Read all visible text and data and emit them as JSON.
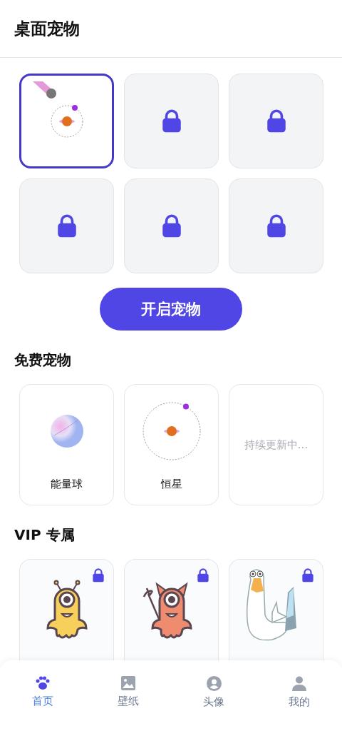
{
  "header": {
    "title": "桌面宠物"
  },
  "slots": [
    {
      "kind": "star",
      "selected": true
    },
    {
      "kind": "locked",
      "selected": false
    },
    {
      "kind": "locked",
      "selected": false
    },
    {
      "kind": "locked",
      "selected": false
    },
    {
      "kind": "locked",
      "selected": false
    },
    {
      "kind": "locked",
      "selected": false
    }
  ],
  "start_button": "开启宠物",
  "free_section": {
    "title": "免费宠物",
    "items": [
      {
        "kind": "orb",
        "label": "能量球"
      },
      {
        "kind": "star",
        "label": "恒星"
      },
      {
        "kind": "placeholder",
        "label": "持续更新中..."
      }
    ]
  },
  "vip_section": {
    "title": "VIP 专属",
    "items": [
      {
        "kind": "alien",
        "locked": true
      },
      {
        "kind": "devil",
        "locked": true
      },
      {
        "kind": "goose",
        "locked": true
      }
    ]
  },
  "tab_bar": [
    {
      "label": "首页",
      "kind": "paw",
      "selected": true
    },
    {
      "label": "壁纸",
      "kind": "image",
      "selected": false
    },
    {
      "label": "头像",
      "kind": "avatar",
      "selected": false
    },
    {
      "label": "我的",
      "kind": "person",
      "selected": false
    }
  ]
}
